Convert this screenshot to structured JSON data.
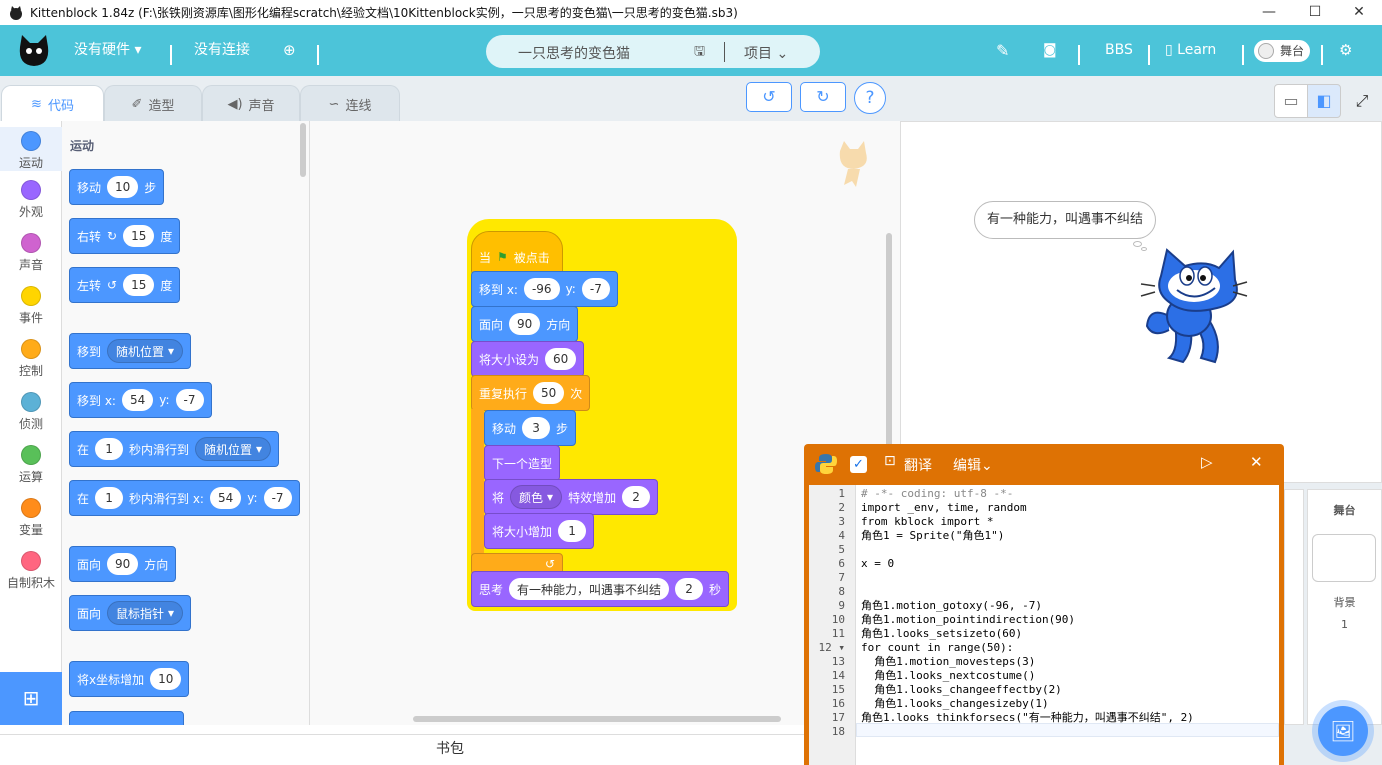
{
  "window": {
    "title": "Kittenblock 1.84z (F:\\张铁刚资源库\\图形化编程scratch\\经验文档\\10Kittenblock实例，一只思考的变色猫\\一只思考的变色猫.sb3)",
    "min": "—",
    "max": "☐",
    "close": "✕"
  },
  "menubar": {
    "hardware": "没有硬件",
    "connection": "没有连接",
    "project_name": "一只思考的变色猫",
    "project_menu": "项目",
    "bbs": "BBS",
    "learn": "Learn",
    "stage_toggle": "舞台"
  },
  "tabs": [
    {
      "label": "代码"
    },
    {
      "label": "造型"
    },
    {
      "label": "声音"
    },
    {
      "label": "连线"
    }
  ],
  "categories": [
    {
      "label": "运动",
      "color": "#4c97ff"
    },
    {
      "label": "外观",
      "color": "#9966ff"
    },
    {
      "label": "声音",
      "color": "#cf63cf"
    },
    {
      "label": "事件",
      "color": "#ffd500"
    },
    {
      "label": "控制",
      "color": "#ffab19"
    },
    {
      "label": "侦测",
      "color": "#5cb1d6"
    },
    {
      "label": "运算",
      "color": "#59c059"
    },
    {
      "label": "变量",
      "color": "#ff8c1a"
    },
    {
      "label": "自制积木",
      "color": "#ff6680"
    }
  ],
  "palette": {
    "heading": "运动",
    "b1": {
      "a": "移动",
      "v": "10",
      "b": "步"
    },
    "b2": {
      "a": "右转",
      "v": "15",
      "b": "度"
    },
    "b3": {
      "a": "左转",
      "v": "15",
      "b": "度"
    },
    "b4": {
      "a": "移到",
      "dd": "随机位置"
    },
    "b5": {
      "a": "移到 x:",
      "x": "54",
      "y": "-7"
    },
    "b6": {
      "a": "在",
      "v": "1",
      "b": "秒内滑行到",
      "dd": "随机位置"
    },
    "b7": {
      "a": "在",
      "v": "1",
      "b": "秒内滑行到 x:",
      "x": "54",
      "y": "-7"
    },
    "b8": {
      "a": "面向",
      "v": "90",
      "b": "方向"
    },
    "b9": {
      "a": "面向",
      "dd": "鼠标指针"
    },
    "b10": {
      "a": "将x坐标增加",
      "v": "10"
    }
  },
  "script": {
    "hat_a": "当",
    "hat_b": "被点击",
    "goto_a": "移到 x:",
    "goto_x": "-96",
    "goto_y": "-7",
    "point_a": "面向",
    "point_v": "90",
    "point_b": "方向",
    "size_a": "将大小设为",
    "size_v": "60",
    "rep_a": "重复执行",
    "rep_v": "50",
    "rep_b": "次",
    "move_a": "移动",
    "move_v": "3",
    "move_b": "步",
    "next": "下一个造型",
    "eff_a": "将",
    "eff_dd": "颜色",
    "eff_b": "特效增加",
    "eff_v": "2",
    "chg_a": "将大小增加",
    "chg_v": "1",
    "think_a": "思考",
    "think_text": "有一种能力，叫遇事不纠结",
    "think_secs": "2",
    "think_b": "秒"
  },
  "stage": {
    "bubble": "有一种能力，叫遇事不纠结"
  },
  "sidepanel": {
    "stage_label": "舞台",
    "backdrop_label": "背景",
    "backdrop_count": "1"
  },
  "backpack": "书包",
  "python": {
    "translate": "翻译",
    "edit": "编辑"
  },
  "code": [
    "# -*- coding: utf-8 -*-",
    "import _env, time, random",
    "from kblock import *",
    "角色1 = Sprite(\"角色1\")",
    "",
    "x = 0",
    "",
    "",
    "角色1.motion_gotoxy(-96, -7)",
    "角色1.motion_pointindirection(90)",
    "角色1.looks_setsizeto(60)",
    "for count in range(50):",
    "  角色1.motion_movesteps(3)",
    "  角色1.looks_nextcostume()",
    "  角色1.looks_changeeffectby(2)",
    "  角色1.looks_changesizeby(1)",
    "角色1.looks_thinkforsecs(\"有一种能力，叫遇事不纠结\", 2)",
    ""
  ]
}
